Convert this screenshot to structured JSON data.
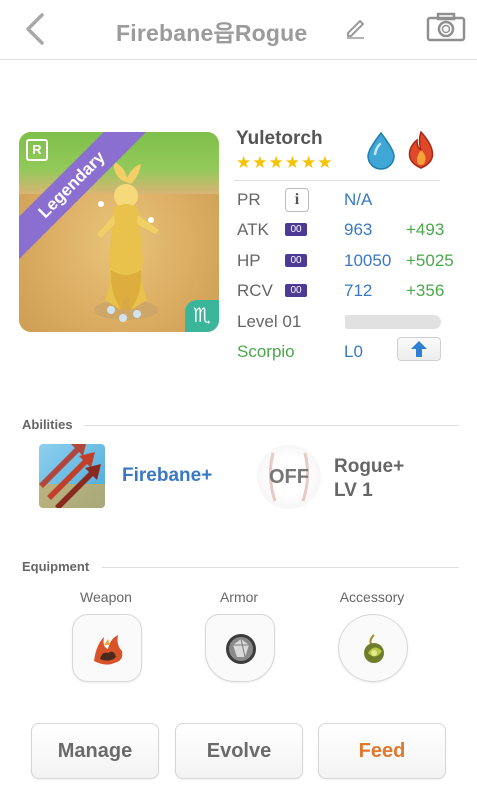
{
  "header": {
    "title": "Firebane읍Rogue",
    "back_icon": "chevron-left-icon",
    "edit_icon": "pencil-icon",
    "camera_icon": "camera-icon"
  },
  "monster": {
    "rank_badge": "R",
    "rarity": "Legendary",
    "rarity_color": "#8a6fd0",
    "zodiac_symbol": "♏",
    "name": "Yuletorch",
    "stars": "★★★★★★",
    "element_icons": [
      "water-drop-icon",
      "fire-icon"
    ]
  },
  "stats": {
    "pr_label": "PR",
    "pr_value": "N/A",
    "atk_label": "ATK",
    "atk_tag": "00",
    "atk_value": "963",
    "atk_bonus": "+493",
    "hp_label": "HP",
    "hp_tag": "00",
    "hp_value": "10050",
    "hp_bonus": "+5025",
    "rcv_label": "RCV",
    "rcv_tag": "00",
    "rcv_value": "712",
    "rcv_bonus": "+356",
    "level_label": "Level 01",
    "level_progress": 0.04,
    "zodiac_label": "Scorpio",
    "zodiac_level": "L0"
  },
  "abilities": {
    "section_title": "Abilities",
    "primary_name": "Firebane+",
    "off_label": "OFF",
    "secondary_name": "Rogue+",
    "secondary_level": "LV 1"
  },
  "equipment": {
    "section_title": "Equipment",
    "weapon_label": "Weapon",
    "armor_label": "Armor",
    "accessory_label": "Accessory"
  },
  "actions": {
    "manage": "Manage",
    "evolve": "Evolve",
    "feed": "Feed",
    "feed_color": "#e0782e"
  }
}
